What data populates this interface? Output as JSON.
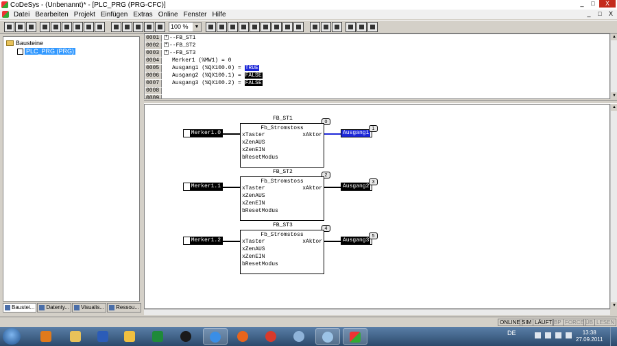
{
  "window": {
    "title": "CoDeSys - (Unbenannt)* - [PLC_PRG (PRG-CFC)]",
    "controls": [
      "_",
      "□",
      "X"
    ]
  },
  "menu": {
    "items": [
      "Datei",
      "Bearbeiten",
      "Projekt",
      "Einfügen",
      "Extras",
      "Online",
      "Fenster",
      "Hilfe"
    ],
    "mdi_controls": [
      "_",
      "□",
      "X"
    ]
  },
  "toolbar": {
    "zoom_value": "100 %"
  },
  "tree": {
    "root_label": "Bausteine",
    "child_label": "PLC_PRG (PRG)",
    "child_icon": "pou-icon"
  },
  "left_tabs": [
    "Baustei...",
    "Datenty...",
    "Visualis...",
    "Ressou..."
  ],
  "declarations": {
    "line_numbers": [
      "0001",
      "0002",
      "0003",
      "0004",
      "0005",
      "0006",
      "0007",
      "0008",
      "0009"
    ],
    "fb_lines": [
      "FB_ST1",
      "FB_ST2",
      "FB_ST3"
    ],
    "merker_line": "Merker1 (%MW1) = 0",
    "outputs": [
      {
        "text": "Ausgang1 (%QX100.0) = ",
        "value": "TRUE"
      },
      {
        "text": "Ausgang2 (%QX100.1) = ",
        "value": "FALSE"
      },
      {
        "text": "Ausgang3 (%QX100.2) = ",
        "value": "FALSE"
      }
    ]
  },
  "cfc": {
    "blocks": [
      {
        "instance": "FB_ST1",
        "type": "Fb_Stromstoss",
        "order": "0",
        "inputs": [
          "xTaster",
          "xZenAUS",
          "xZenEIN",
          "bResetModus"
        ],
        "output": "xAktor",
        "input_var": "Merker1.0",
        "output_var": "Ausgang1",
        "output_order": "1",
        "output_state": "TRUE"
      },
      {
        "instance": "FB_ST2",
        "type": "Fb_Stromstoss",
        "order": "2",
        "inputs": [
          "xTaster",
          "xZenAUS",
          "xZenEIN",
          "bResetModus"
        ],
        "output": "xAktor",
        "input_var": "Merker1.1",
        "output_var": "Ausgang2",
        "output_order": "3",
        "output_state": "FALSE"
      },
      {
        "instance": "FB_ST3",
        "type": "Fb_Stromstoss",
        "order": "4",
        "inputs": [
          "xTaster",
          "xZenAUS",
          "xZenEIN",
          "bResetModus"
        ],
        "output": "xAktor",
        "input_var": "Merker1.2",
        "output_var": "Ausgang3",
        "output_order": "5",
        "output_state": "FALSE"
      }
    ]
  },
  "status": {
    "fields": [
      {
        "label": "ONLINE",
        "active": true
      },
      {
        "label": "SIM",
        "active": true
      },
      {
        "label": "LÄUFT",
        "active": true
      },
      {
        "label": "BP",
        "active": false
      },
      {
        "label": "FORCE",
        "active": false
      },
      {
        "label": "ÜB",
        "active": false
      },
      {
        "label": "LESEN",
        "active": false
      }
    ]
  },
  "taskbar": {
    "language": "DE",
    "time": "13:38",
    "date": "27.09.2011",
    "apps": [
      "media-player-icon",
      "explorer-icon",
      "word-icon",
      "email-icon",
      "excel-icon",
      "hp-icon",
      "ie-icon",
      "firefox-icon",
      "chrome-icon",
      "compass-icon",
      "calibrate-icon",
      "codesys-icon"
    ]
  },
  "colors": {
    "true_value": "#1c27d8",
    "false_value": "#000000",
    "selection": "#3399ff"
  }
}
